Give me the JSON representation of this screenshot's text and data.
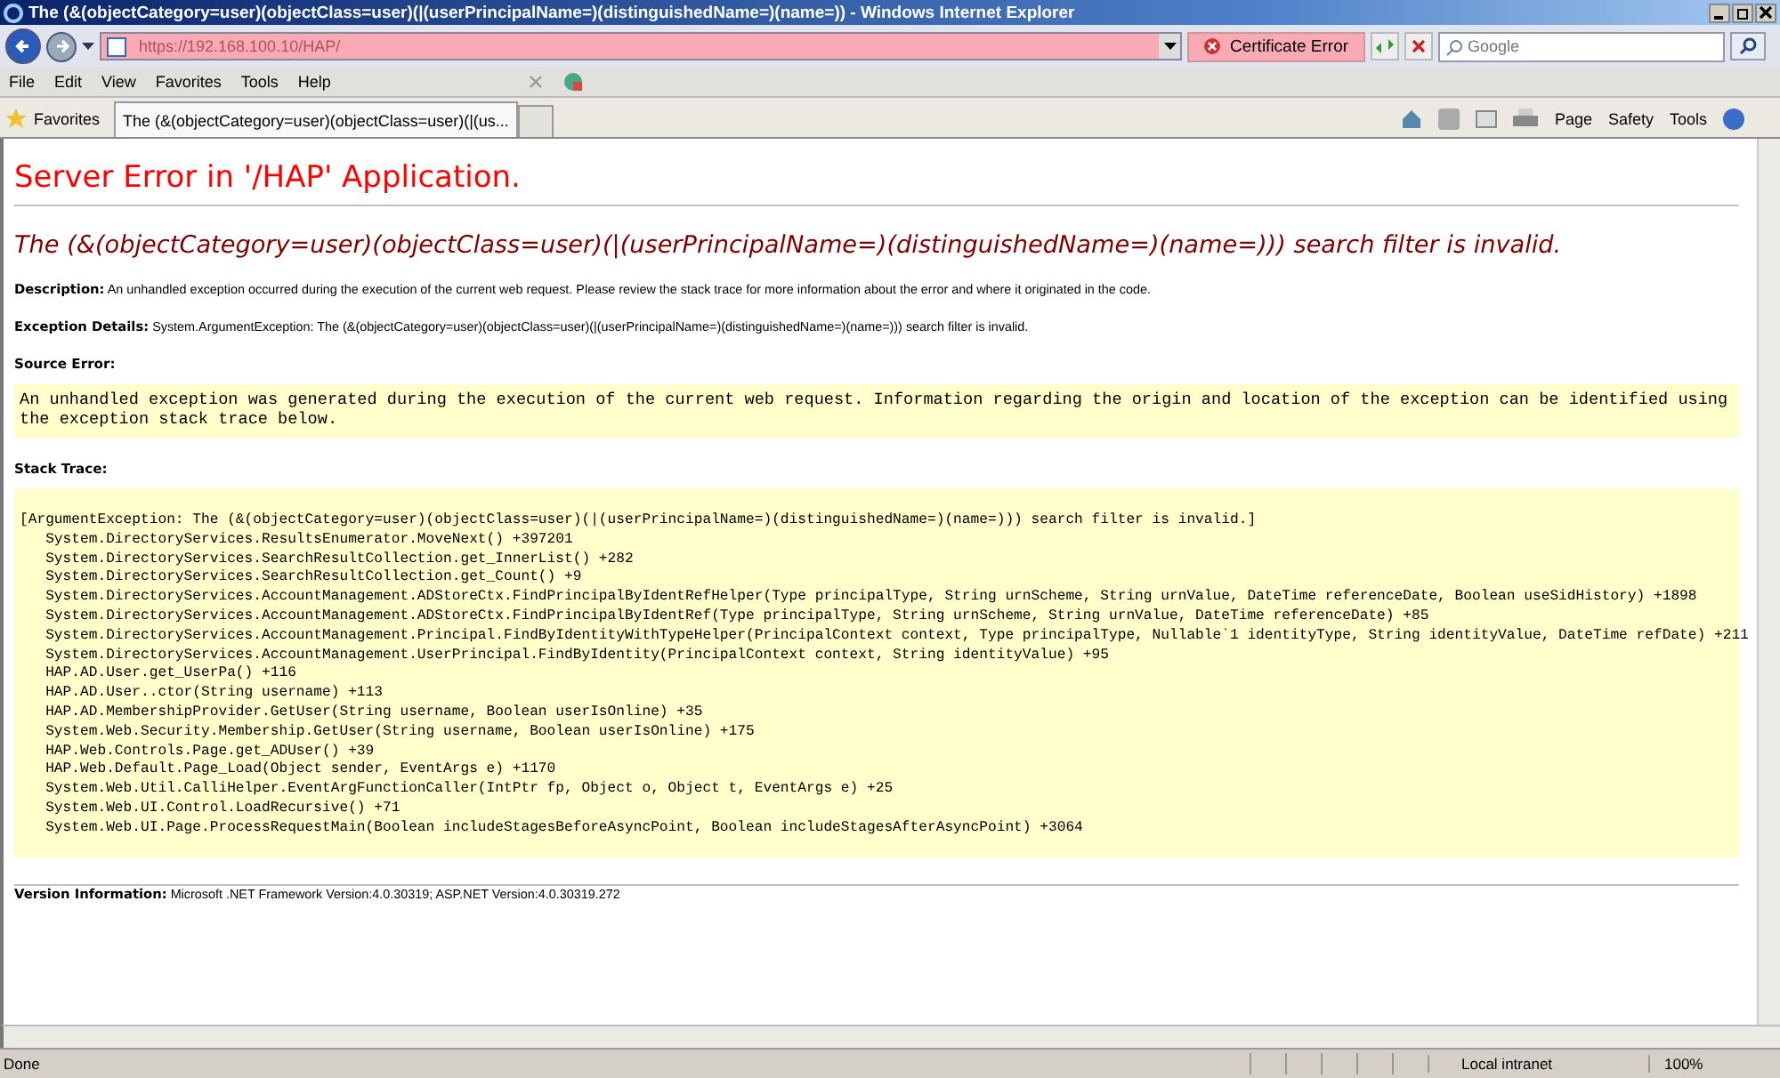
{
  "window": {
    "title": "The (&(objectCategory=user)(objectClass=user)(|(userPrincipalName=)(distinguishedName=)(name=)) - Windows Internet Explorer"
  },
  "address_bar": {
    "url": "https://192.168.100.10/HAP/",
    "certificate_status": "Certificate Error"
  },
  "search": {
    "placeholder": "Google"
  },
  "menu": [
    "File",
    "Edit",
    "View",
    "Favorites",
    "Tools",
    "Help"
  ],
  "favorites": {
    "label": "Favorites"
  },
  "tabs": [
    {
      "title": "The (&(objectCategory=user)(objectClass=user)(|(us...",
      "selected": true
    }
  ],
  "command_bar": [
    "Page",
    "Safety",
    "Tools"
  ],
  "page": {
    "heading": "Server Error in '/HAP' Application.",
    "error_title": "The (&(objectCategory=user)(objectClass=user)(|(userPrincipalName=)(distinguishedName=)(name=))) search filter is invalid.",
    "description": "**Description:** An unhandled exception occurred during the execution of the current web request. Please review the stack trace for more information about the error and where it originated in the code.",
    "exception_details": "**Exception Details:** System.ArgumentException: The (&(objectCategory=user)(objectClass=user)(|(userPrincipalName=)(distinguishedName=)(name=))) search filter is invalid.",
    "source_error_label": "Source Error:",
    "source_error": "An unhandled exception was generated during the execution of the current web request. Information regarding the origin and location of the exception can be identified using the exception stack trace below.",
    "stack_trace_label": "Stack Trace:",
    "stack_trace": [
      "[ArgumentException: The (&(objectCategory=user)(objectClass=user)(|(userPrincipalName=)(distinguishedName=)(name=))) search filter is invalid.]",
      "   System.DirectoryServices.ResultsEnumerator.MoveNext() +397201",
      "   System.DirectoryServices.SearchResultCollection.get_InnerList() +282",
      "   System.DirectoryServices.SearchResultCollection.get_Count() +9",
      "   System.DirectoryServices.AccountManagement.ADStoreCtx.FindPrincipalByIdentRefHelper(Type principalType, String urnScheme, String urnValue, DateTime referenceDate, Boolean useSidHistory) +1898",
      "   System.DirectoryServices.AccountManagement.ADStoreCtx.FindPrincipalByIdentRef(Type principalType, String urnScheme, String urnValue, DateTime referenceDate) +85",
      "   System.DirectoryServices.AccountManagement.Principal.FindByIdentityWithTypeHelper(PrincipalContext context, Type principalType, Nullable`1 identityType, String identityValue, DateTime refDate) +211",
      "   System.DirectoryServices.AccountManagement.UserPrincipal.FindByIdentity(PrincipalContext context, String identityValue) +95",
      "   HAP.AD.User.get_UserPa() +116",
      "   HAP.AD.User..ctor(String username) +113",
      "   HAP.AD.MembershipProvider.GetUser(String username, Boolean userIsOnline) +35",
      "   System.Web.Security.Membership.GetUser(String username, Boolean userIsOnline) +175",
      "   HAP.Web.Controls.Page.get_ADUser() +39",
      "   HAP.Web.Default.Page_Load(Object sender, EventArgs e) +1170",
      "   System.Web.Util.CalliHelper.EventArgFunctionCaller(IntPtr fp, Object o, Object t, EventArgs e) +25",
      "   System.Web.UI.Control.LoadRecursive() +71",
      "   System.Web.UI.Page.ProcessRequestMain(Boolean includeStagesBeforeAsyncPoint, Boolean includeStagesAfterAsyncPoint) +3064"
    ],
    "version_info": "**Version Information:** Microsoft .NET Framework Version:4.0.30319; ASP.NET Version:4.0.30319.272"
  },
  "status_bar": {
    "text": "Done",
    "zone": "Local intranet",
    "zoom": "100%"
  }
}
